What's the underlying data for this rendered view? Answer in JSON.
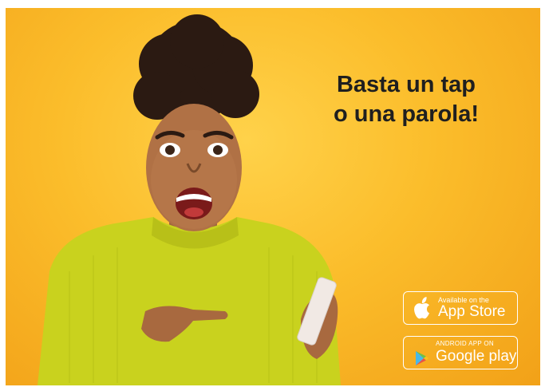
{
  "headline": {
    "line1": "Basta un tap",
    "line2": "o una parola!"
  },
  "app_store": {
    "small_label": "Available on the",
    "big_label": "App Store",
    "icon": "apple-icon"
  },
  "google_play": {
    "small_label": "ANDROID APP ON",
    "big_label": "Google play",
    "icon": "google-play-icon"
  },
  "colors": {
    "background": "#fbbd2b",
    "headline_text": "#1f1f1f",
    "sweater": "#c9d21e",
    "badge": "#ffffff"
  }
}
